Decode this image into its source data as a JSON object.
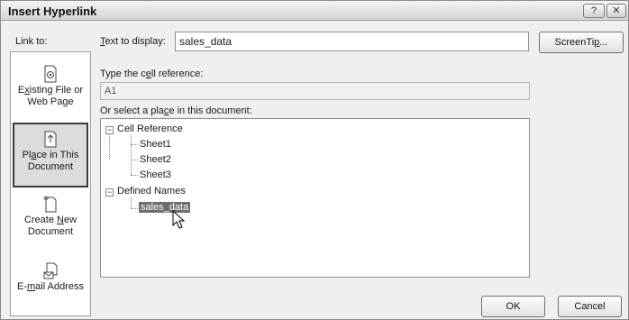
{
  "window": {
    "title": "Insert Hyperlink",
    "help_glyph": "?",
    "close_glyph": "✕"
  },
  "link_to": {
    "label": "Link to:",
    "items": [
      {
        "line1_pre": "E",
        "line1_u": "x",
        "line1_post": "isting File or",
        "line2": "Web Page",
        "icon": "file-icon"
      },
      {
        "line1_pre": "Pl",
        "line1_u": "a",
        "line1_post": "ce in This",
        "line2": "Document",
        "icon": "document-place-icon"
      },
      {
        "line1_pre": "Create ",
        "line1_u": "N",
        "line1_post": "ew",
        "line2": "Document",
        "icon": "new-document-icon"
      },
      {
        "line1_pre": "E-",
        "line1_u": "m",
        "line1_post": "ail Address",
        "line2": "",
        "icon": "email-icon"
      }
    ],
    "selected_index": 1
  },
  "text_to_display": {
    "label_u": "T",
    "label_rest": "ext to display:",
    "value": "sales_data"
  },
  "screentip_button": {
    "pre": "ScreenTi",
    "u": "p",
    "post": "..."
  },
  "cell_reference": {
    "label_pre": "Type the c",
    "label_u": "e",
    "label_post": "ll reference:",
    "value": "A1"
  },
  "place_in_document": {
    "label_pre": "Or select a pla",
    "label_u": "c",
    "label_post": "e in this document:",
    "tree": {
      "cell_reference": {
        "label": "Cell Reference",
        "expanded_glyph": "−",
        "children": [
          "Sheet1",
          "Sheet2",
          "Sheet3"
        ]
      },
      "defined_names": {
        "label": "Defined Names",
        "expanded_glyph": "−",
        "children": [
          "sales_data"
        ]
      }
    },
    "selected_node": "sales_data"
  },
  "buttons": {
    "ok": "OK",
    "cancel": "Cancel"
  },
  "colors": {
    "selection": "#6e6e6e",
    "dialog_bg": "#efefef"
  }
}
